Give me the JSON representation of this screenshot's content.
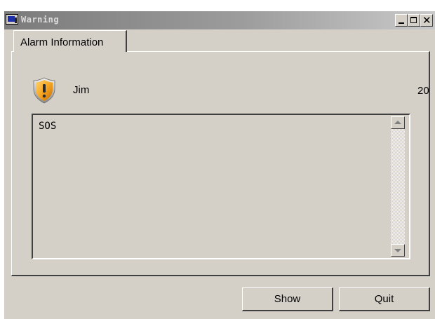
{
  "window": {
    "title": "Warning",
    "controls": {
      "minimize_icon": "minimize-icon",
      "maximize_icon": "maximize-icon",
      "close_icon": "close-icon"
    }
  },
  "tabs": [
    {
      "label": "Alarm Information",
      "active": true
    }
  ],
  "alarm": {
    "icon": "warning-shield-icon",
    "name": "Jim",
    "number": "20",
    "message": "SOS"
  },
  "buttons": {
    "show": "Show",
    "quit": "Quit"
  },
  "colors": {
    "window_bg": "#d4d0c8",
    "shield_orange": "#f5a623"
  }
}
